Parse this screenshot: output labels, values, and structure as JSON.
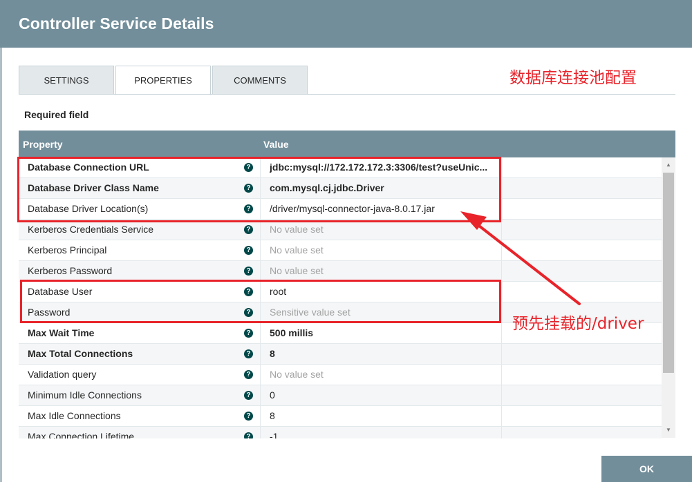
{
  "dialog": {
    "title": "Controller Service Details"
  },
  "tabs": [
    {
      "label": "SETTINGS",
      "active": false
    },
    {
      "label": "PROPERTIES",
      "active": true
    },
    {
      "label": "COMMENTS",
      "active": false
    }
  ],
  "required_label": "Required field",
  "grid": {
    "headers": {
      "property": "Property",
      "value": "Value"
    },
    "info_icon_glyph": "?",
    "rows": [
      {
        "property": "Database Connection URL",
        "value": "jdbc:mysql://172.172.172.3:3306/test?useUnic...",
        "required": true,
        "placeholder": false
      },
      {
        "property": "Database Driver Class Name",
        "value": "com.mysql.cj.jdbc.Driver",
        "required": true,
        "placeholder": false
      },
      {
        "property": "Database Driver Location(s)",
        "value": "/driver/mysql-connector-java-8.0.17.jar",
        "required": false,
        "placeholder": false
      },
      {
        "property": "Kerberos Credentials Service",
        "value": "No value set",
        "required": false,
        "placeholder": true
      },
      {
        "property": "Kerberos Principal",
        "value": "No value set",
        "required": false,
        "placeholder": true
      },
      {
        "property": "Kerberos Password",
        "value": "No value set",
        "required": false,
        "placeholder": true
      },
      {
        "property": "Database User",
        "value": "root",
        "required": false,
        "placeholder": false
      },
      {
        "property": "Password",
        "value": "Sensitive value set",
        "required": false,
        "placeholder": true
      },
      {
        "property": "Max Wait Time",
        "value": "500 millis",
        "required": true,
        "placeholder": false
      },
      {
        "property": "Max Total Connections",
        "value": "8",
        "required": true,
        "placeholder": false
      },
      {
        "property": "Validation query",
        "value": "No value set",
        "required": false,
        "placeholder": true
      },
      {
        "property": "Minimum Idle Connections",
        "value": "0",
        "required": false,
        "placeholder": false
      },
      {
        "property": "Max Idle Connections",
        "value": "8",
        "required": false,
        "placeholder": false
      },
      {
        "property": "Max Connection Lifetime",
        "value": "-1",
        "required": false,
        "placeholder": false
      }
    ]
  },
  "annotations": {
    "pool_config": "数据库连接池配置",
    "driver_note": "预先挂载的/driver"
  },
  "buttons": {
    "ok": "OK"
  },
  "colors": {
    "header_bg": "#728e9b",
    "annotation_red": "#e8232a",
    "info_icon": "#004849"
  }
}
